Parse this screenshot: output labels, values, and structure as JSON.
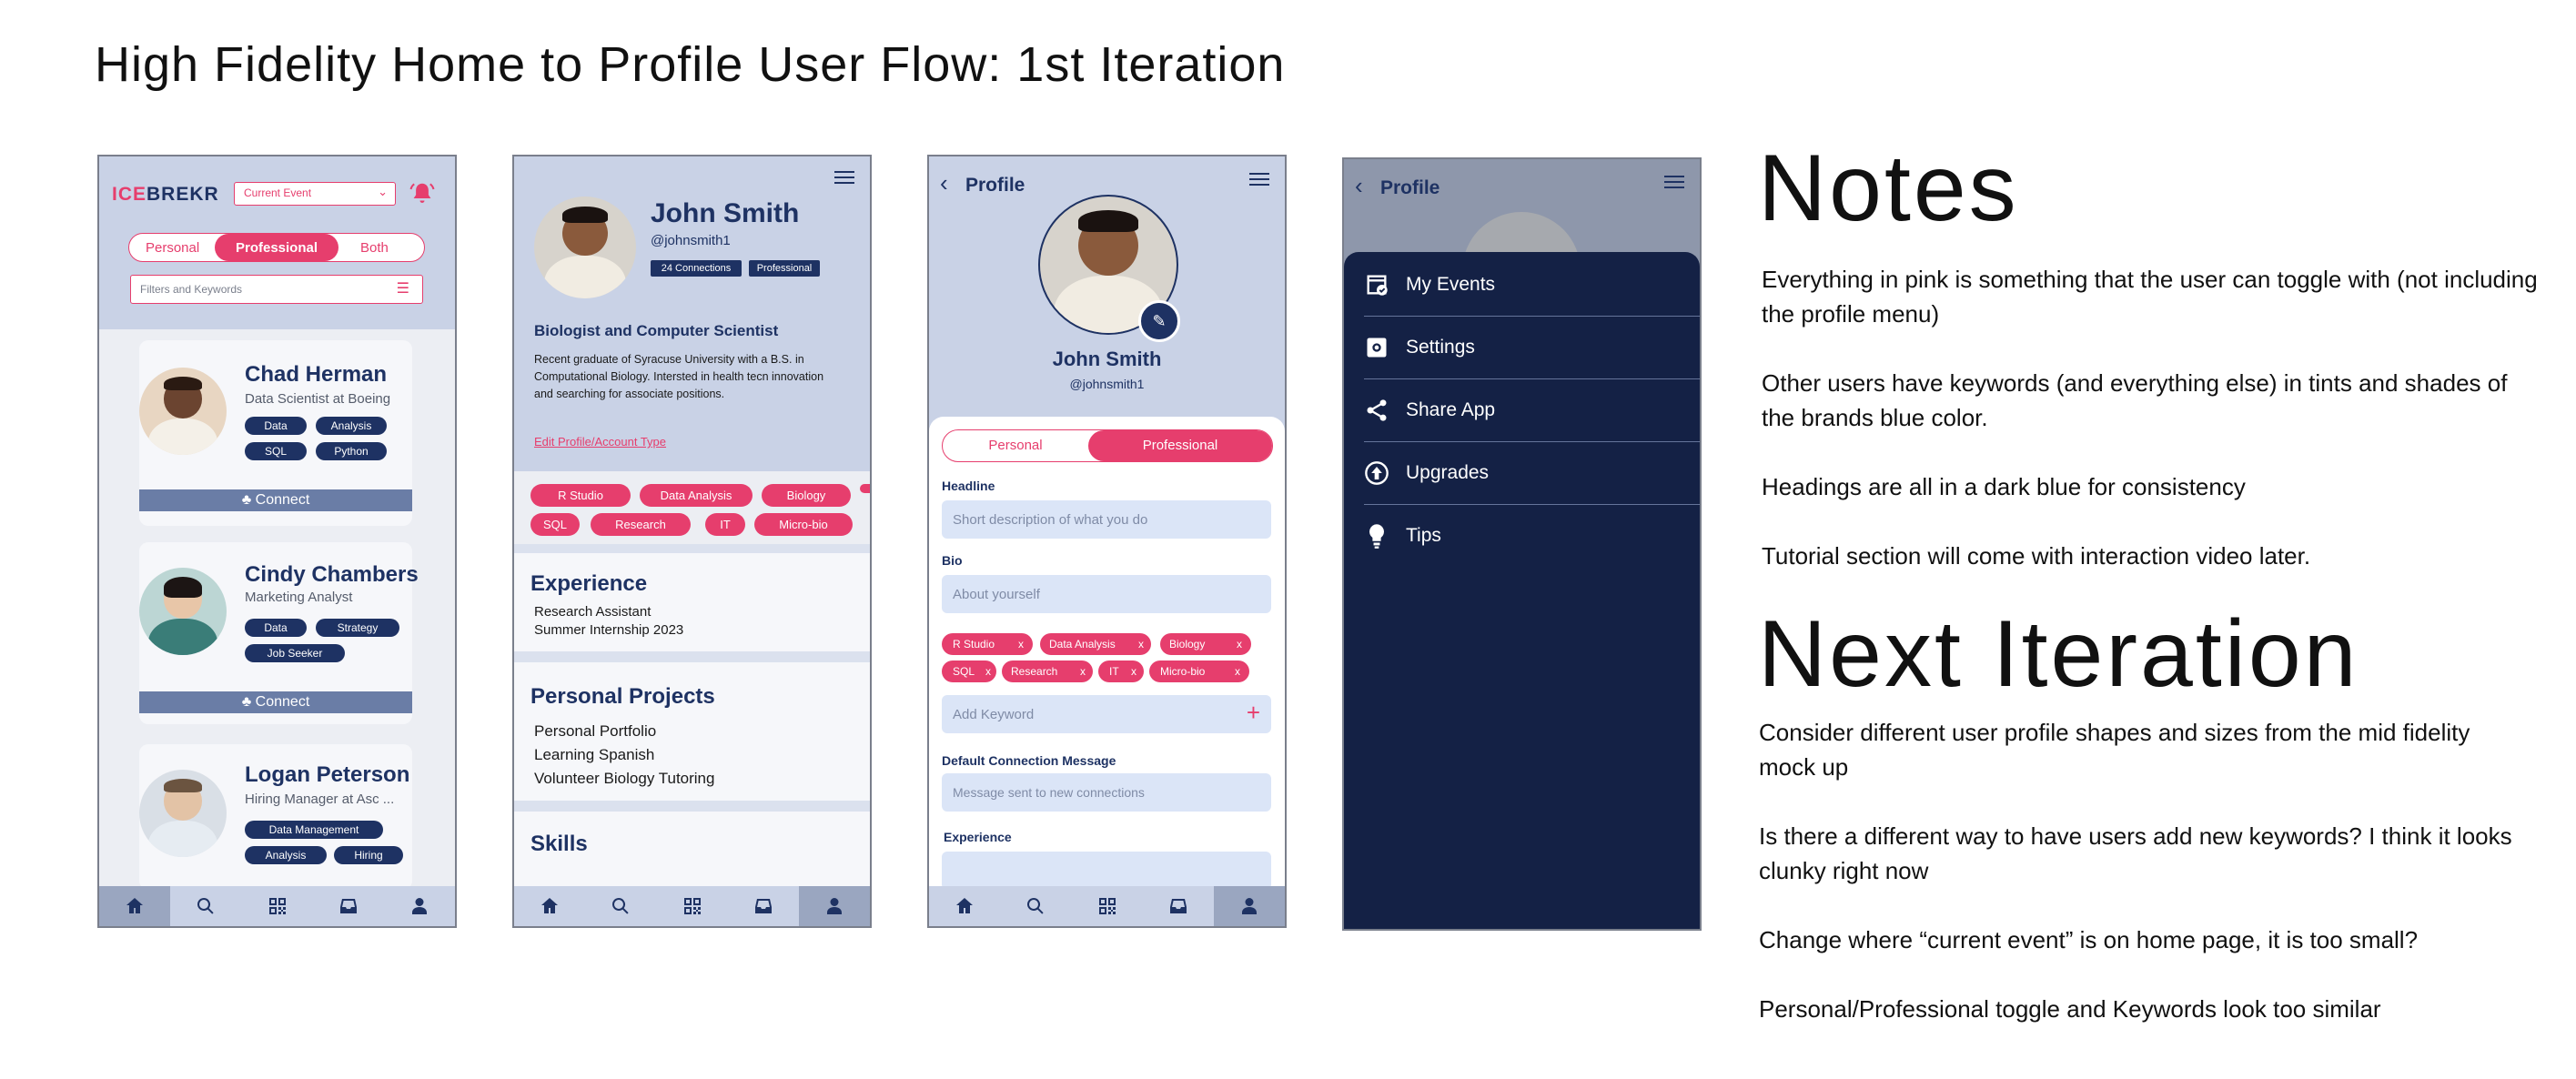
{
  "page_title": "High Fidelity Home to Profile User Flow: 1st Iteration",
  "colors": {
    "brand_blue": "#1e3263",
    "pink": "#e63e6d",
    "light_blue": "#c9d2e6",
    "menu_bg": "#142145"
  },
  "home": {
    "logo_ice": "ICE",
    "logo_brekr": "BREKR",
    "event_select": "Current Event",
    "toggle": [
      "Personal",
      "Professional",
      "Both"
    ],
    "filter_placeholder": "Filters and Keywords",
    "connect_label": "Connect",
    "users": [
      {
        "name": "Chad Herman",
        "role": "Data Scientist at Boeing",
        "tags": [
          "Data",
          "Analysis",
          "SQL",
          "Python"
        ]
      },
      {
        "name": "Cindy Chambers",
        "role": "Marketing Analyst",
        "tags": [
          "Data",
          "Strategy",
          "Job Seeker"
        ]
      },
      {
        "name": "Logan Peterson",
        "role": "Hiring Manager at Asc ...",
        "tags": [
          "Data Management",
          "Analysis",
          "Hiring"
        ]
      }
    ]
  },
  "profile": {
    "name": "John Smith",
    "handle": "@johnsmith1",
    "connections": "24 Connections",
    "type_badge": "Professional",
    "headline": "Biologist and Computer Scientist",
    "bio": "Recent graduate of Syracuse University with a B.S. in Computational Biology. Intersted in health tecn innovation and searching for associate positions.",
    "edit_link": "Edit Profile/Account Type",
    "keywords": [
      "R Studio",
      "Data Analysis",
      "Biology",
      "SQL",
      "Research",
      "IT",
      "Micro-bio"
    ],
    "experience_title": "Experience",
    "experience_items": [
      "Research Assistant",
      "Summer Internship 2023"
    ],
    "projects_title": "Personal Projects",
    "projects_items": [
      "Personal Portfolio",
      "Learning Spanish",
      "Volunteer Biology Tutoring"
    ],
    "skills_title": "Skills"
  },
  "edit": {
    "back_title": "Profile",
    "name": "John Smith",
    "handle": "@johnsmith1",
    "toggle": [
      "Personal",
      "Professional"
    ],
    "headline_label": "Headline",
    "headline_placeholder": "Short description of what you do",
    "bio_label": "Bio",
    "bio_placeholder": "About yourself",
    "chips": [
      "R Studio",
      "Data Analysis",
      "Biology",
      "SQL",
      "Research",
      "IT",
      "Micro-bio"
    ],
    "chip_remove": "x",
    "add_keyword": "Add Keyword",
    "add_symbol": "+",
    "default_msg_label": "Default Connection Message",
    "default_msg_placeholder": "Message sent to new connections",
    "experience_label": "Experience"
  },
  "menu": {
    "back_title": "Profile",
    "items": [
      "My Events",
      "Settings",
      "Share App",
      "Upgrades",
      "Tips"
    ]
  },
  "notes": {
    "heading": "Notes",
    "items": [
      "Everything in pink is something that the user can toggle with (not including the profile menu)",
      "Other users have keywords (and everything else) in tints and shades of the brands blue color.",
      "Headings are all in a dark blue for consistency",
      "Tutorial section will come with interaction video later."
    ]
  },
  "next": {
    "heading": "Next Iteration",
    "items": [
      "Consider different user profile shapes and sizes from the mid fidelity mock up",
      "Is there a different way to have users add new keywords? I think it looks clunky right now",
      "Change where “current event” is on home page, it is too small?",
      "Personal/Professional toggle and Keywords look too similar"
    ]
  }
}
